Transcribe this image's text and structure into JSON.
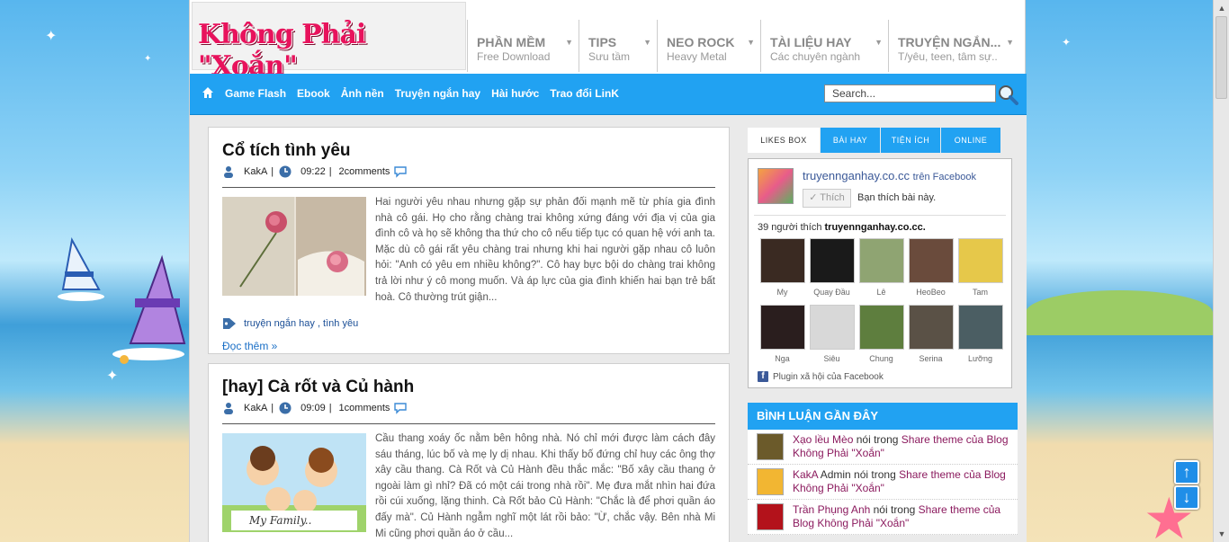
{
  "site": {
    "logo_text": "Không Phải \"Xoắn\""
  },
  "top_nav": [
    {
      "title": "PHẦN MỀM",
      "sub": "Free Download",
      "w": 124
    },
    {
      "title": "TIPS",
      "sub": "Sưu tầm",
      "w": 87
    },
    {
      "title": "NEO ROCK",
      "sub": "Heavy Metal",
      "w": 115
    },
    {
      "title": "TÀI LIỆU HAY",
      "sub": "Các chuyên ngành",
      "w": 142
    },
    {
      "title": "TRUYỆN NGẮN...",
      "sub": "T/yêu, teen, tâm sự..",
      "w": 146
    }
  ],
  "blue_nav": {
    "links": [
      "Game Flash",
      "Ebook",
      "Ảnh nền",
      "Truyện ngắn hay",
      "Hài hước",
      "Trao đổi LinK"
    ],
    "search_placeholder": "Search..."
  },
  "posts": [
    {
      "title": "Cổ tích tình yêu",
      "author": "KakA",
      "time": "09:22",
      "comments": "2comments",
      "excerpt": "Hai người yêu nhau nhưng gặp sự phản đối mạnh mẽ từ phía gia đình nhà cô gái. Họ cho rằng chàng trai không xứng đáng với địa vị của gia đình cô và họ sẽ không tha thứ cho cô nếu tiếp tục có quan hệ với anh ta. Mặc dù cô gái rất yêu chàng trai nhưng khi hai người gặp nhau cô luôn hỏi: \"Anh có yêu em nhiều không?\". Cô hay bực bội do chàng trai không trả lời như ý cô mong muốn. Và áp lực của gia đình khiến hai bạn trẻ bất hoà. Cô thường trút giận...",
      "tags": "truyện ngắn hay , tình yêu",
      "read_more": "Đọc thêm »"
    },
    {
      "title": "[hay] Cà rốt và Củ hành",
      "author": "KakA",
      "time": "09:09",
      "comments": "1comments",
      "excerpt": "Cầu thang xoáy ốc nằm bên hông nhà. Nó chỉ mới được làm cách đây sáu tháng, lúc bố và mẹ ly dị nhau. Khi thấy bố đứng chỉ huy các ông thợ xây cầu thang. Cà Rốt và Củ Hành đều thắc mắc: \"Bố xây cầu thang ở ngoài làm gì nhỉ? Đã có một cái trong nhà rồi\". Mẹ đưa mắt nhìn hai đứa rồi cúi xuống, lặng thinh. Cà Rốt bảo Củ Hành: \"Chắc là để phơi quần áo đấy mà\". Củ Hành ngẫm nghĩ một lát rồi bảo: \"Ừ, chắc vậy. Bên nhà Mi Mi cũng phơi quần áo ở cầu...",
      "thumb_caption": "My Family.."
    }
  ],
  "sidebar": {
    "tabs": [
      {
        "label": "LIKES BOX",
        "active": true
      },
      {
        "label": "BÀI HAY",
        "active": false
      },
      {
        "label": "TIỆN ÍCH",
        "active": false
      },
      {
        "label": "ONLINE",
        "active": false
      }
    ],
    "likebox": {
      "page_name": "truyennganhay.co.cc",
      "on_facebook": "trên Facebook",
      "like_button": "✓ Thích",
      "like_message": "Bạn thích bài này.",
      "count_text": "39 người thích ",
      "count_page": "truyennganhay.co.cc.",
      "faces": [
        {
          "name": "My",
          "color": "#3a2a22"
        },
        {
          "name": "Quay Đầu",
          "color": "#1a1a1a"
        },
        {
          "name": "Lê",
          "color": "#8fa472"
        },
        {
          "name": "HeoBeo",
          "color": "#6a4b3c"
        },
        {
          "name": "Tam",
          "color": "#e6c84a"
        },
        {
          "name": "Nga",
          "color": "#2a1e1e"
        },
        {
          "name": "Siêu",
          "color": "#d8d8d8"
        },
        {
          "name": "Chung",
          "color": "#5e7e3e"
        },
        {
          "name": "Serina",
          "color": "#5a5146"
        },
        {
          "name": "Lưỡng",
          "color": "#4b5e63"
        }
      ],
      "plugin_text": "Plugin xã hội của Facebook"
    },
    "comments_heading": "BÌNH LUẬN GẦN ĐÂY",
    "comments": [
      {
        "user": "Xạo lều Mèo",
        "admin": "",
        "mid": " nói trong ",
        "link": "Share theme của Blog Không Phải \"Xoắn\"",
        "color": "#6b5a2a"
      },
      {
        "user": "KakA",
        "admin": " Admin",
        "mid": " nói trong ",
        "link": "Share theme của Blog Không Phải \"Xoắn\"",
        "color": "#f2b632"
      },
      {
        "user": "Trần Phụng Anh",
        "admin": "",
        "mid": " nói trong ",
        "link": "Share theme của Blog Không Phải \"Xoắn\"",
        "color": "#b3121b"
      }
    ]
  },
  "float_buttons": {
    "up": "↑",
    "down": "↓"
  }
}
